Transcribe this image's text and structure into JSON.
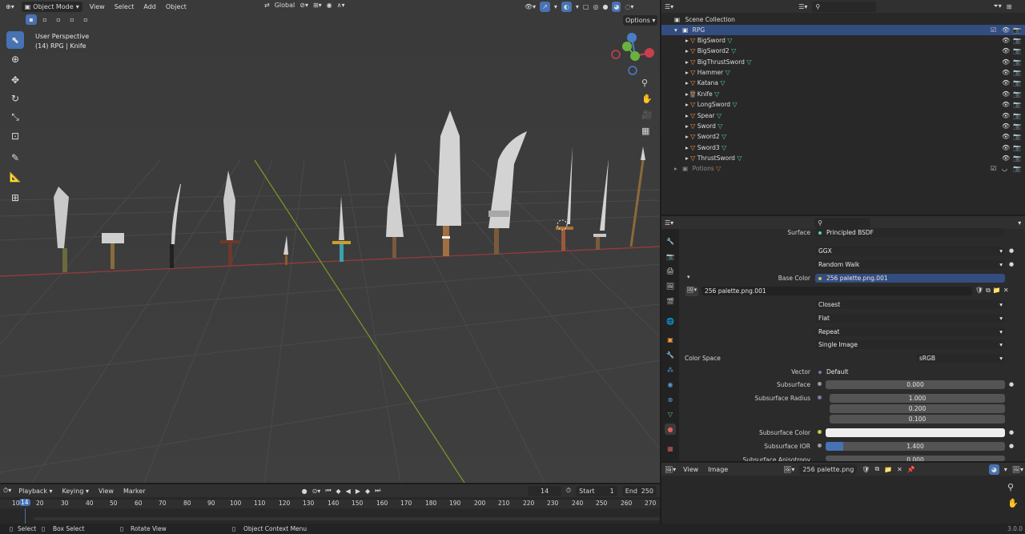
{
  "viewport_header": {
    "mode": "Object Mode",
    "menus": [
      "View",
      "Select",
      "Add",
      "Object"
    ],
    "orientation": "Global",
    "options": "Options"
  },
  "viewport_info": {
    "line1": "User Perspective",
    "line2": "(14) RPG | Knife"
  },
  "outliner": {
    "root": "Scene Collection",
    "collection": "RPG",
    "items": [
      "BigSword",
      "BigSword2",
      "BigThrustSword",
      "Hammer",
      "Katana",
      "Knife",
      "LongSword",
      "Spear",
      "Sword",
      "Sword2",
      "Sword3",
      "ThrustSword"
    ],
    "potions": "Potions"
  },
  "properties": {
    "surface_label": "Surface",
    "surface_value": "Principled BSDF",
    "distribution": "GGX",
    "subsurface_method": "Random Walk",
    "base_color_label": "Base Color",
    "base_color_value": "256 palette.png.001",
    "image_name": "256 palette.png.001",
    "interpolation": "Closest",
    "projection": "Flat",
    "extension": "Repeat",
    "source": "Single Image",
    "color_space_label": "Color Space",
    "color_space_value": "sRGB",
    "vector_label": "Vector",
    "vector_value": "Default",
    "subsurface_label": "Subsurface",
    "subsurface_value": "0.000",
    "subsurface_radius_label": "Subsurface Radius",
    "radius": [
      "1.000",
      "0.200",
      "0.100"
    ],
    "subsurface_color_label": "Subsurface Color",
    "subsurface_ior_label": "Subsurface IOR",
    "subsurface_ior_value": "1.400",
    "subsurface_ior_fill": 0.1,
    "aniso_label": "Subsurface Anisotropy",
    "aniso_value": "0.000"
  },
  "image_editor": {
    "menus": [
      "View",
      "Image"
    ],
    "image": "256 palette.png"
  },
  "timeline": {
    "menus": [
      "Playback",
      "Keying",
      "View",
      "Marker"
    ],
    "current_frame": "14",
    "start_label": "Start",
    "start": "1",
    "end_label": "End",
    "end": "250",
    "ruler": [
      "10",
      "14",
      "20",
      "30",
      "40",
      "50",
      "60",
      "70",
      "80",
      "90",
      "100",
      "110",
      "120",
      "130",
      "140",
      "150",
      "160",
      "170",
      "180",
      "190",
      "200",
      "210",
      "220",
      "230",
      "240",
      "250",
      "260",
      "270"
    ]
  },
  "statusbar": {
    "select": "Select",
    "box_select": "Box Select",
    "rotate_view": "Rotate View",
    "context_menu": "Object Context Menu",
    "version": "3.0.0"
  },
  "colors": {
    "accent": "#4772b3",
    "selected_row": "#334d80",
    "mesh_icon": "#ff9f43",
    "mesh_data": "#58d48f"
  }
}
